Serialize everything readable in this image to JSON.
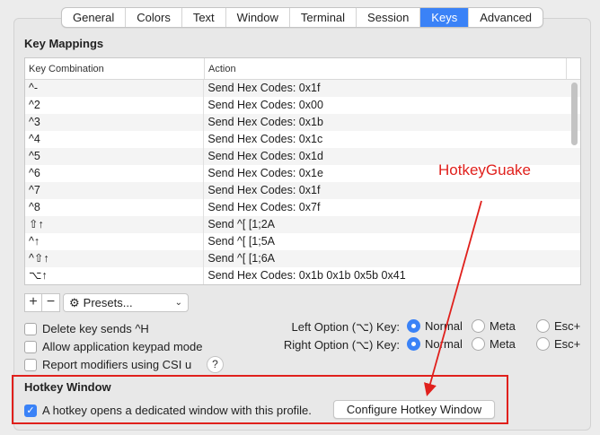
{
  "tabs": [
    {
      "label": "General",
      "active": false
    },
    {
      "label": "Colors",
      "active": false
    },
    {
      "label": "Text",
      "active": false
    },
    {
      "label": "Window",
      "active": false
    },
    {
      "label": "Terminal",
      "active": false
    },
    {
      "label": "Session",
      "active": false
    },
    {
      "label": "Keys",
      "active": true
    },
    {
      "label": "Advanced",
      "active": false
    }
  ],
  "key_mappings": {
    "title": "Key Mappings",
    "columns": [
      "Key Combination",
      "Action"
    ],
    "rows": [
      {
        "key": "^-",
        "action": "Send Hex Codes: 0x1f"
      },
      {
        "key": "^2",
        "action": "Send Hex Codes: 0x00"
      },
      {
        "key": "^3",
        "action": "Send Hex Codes: 0x1b"
      },
      {
        "key": "^4",
        "action": "Send Hex Codes: 0x1c"
      },
      {
        "key": "^5",
        "action": "Send Hex Codes: 0x1d"
      },
      {
        "key": "^6",
        "action": "Send Hex Codes: 0x1e"
      },
      {
        "key": "^7",
        "action": "Send Hex Codes: 0x1f"
      },
      {
        "key": "^8",
        "action": "Send Hex Codes: 0x7f"
      },
      {
        "key": "⇧↑",
        "action": "Send ^[ [1;2A"
      },
      {
        "key": "^↑",
        "action": "Send ^[ [1;5A"
      },
      {
        "key": "^⇧↑",
        "action": "Send ^[ [1;6A"
      },
      {
        "key": "⌥↑",
        "action": "Send Hex Codes: 0x1b 0x1b 0x5b 0x41"
      }
    ]
  },
  "toolbar": {
    "add": "+",
    "remove": "−",
    "presets": "Presets...",
    "gear_icon": "gear-icon",
    "chevron_icon": "chevron-down-icon"
  },
  "options": {
    "delete_key": {
      "label": "Delete key sends ^H",
      "checked": false
    },
    "keypad": {
      "label": "Allow application keypad mode",
      "checked": false
    },
    "csi_u": {
      "label": "Report modifiers using CSI u",
      "checked": false
    },
    "help": "?"
  },
  "left_option": {
    "label": "Left Option (⌥) Key:",
    "choices": [
      "Normal",
      "Meta",
      "Esc+"
    ],
    "selected": "Normal"
  },
  "right_option": {
    "label": "Right Option (⌥) Key:",
    "choices": [
      "Normal",
      "Meta",
      "Esc+"
    ],
    "selected": "Normal"
  },
  "hotkey": {
    "title": "Hotkey Window",
    "checkbox_label": "A hotkey opens a dedicated window with this profile.",
    "checked": true,
    "button": "Configure Hotkey Window"
  },
  "annotation": {
    "text": "HotkeyGuake",
    "color": "#e0201c"
  },
  "colors": {
    "accent": "#3a82f7",
    "annotation": "#e0201c"
  }
}
